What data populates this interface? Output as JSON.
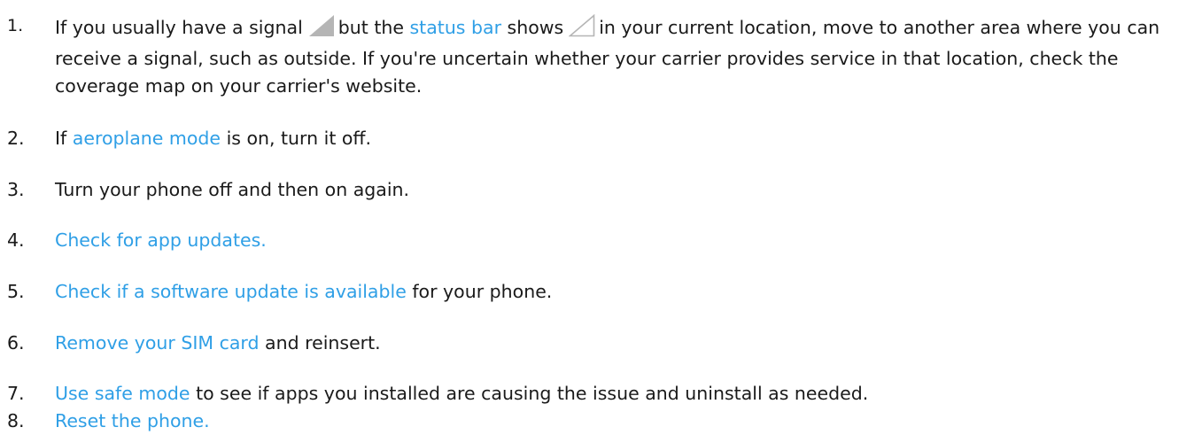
{
  "steps": [
    {
      "number": "1.",
      "parts": {
        "a": "If you usually have a signal",
        "b": "but the",
        "link": "status bar",
        "c": "shows",
        "d": "in your current location, move to another area where you can receive a signal, such as outside. If you're uncertain whether your carrier provides service in that location, check the coverage map on your carrier's website."
      },
      "icons": [
        "signal-full-icon",
        "signal-empty-icon"
      ]
    },
    {
      "number": "2.",
      "parts": {
        "pre": "If",
        "link": "aeroplane mode",
        "post": "is on, turn it off."
      }
    },
    {
      "number": "3.",
      "parts": {
        "text": "Turn your phone off and then on again."
      }
    },
    {
      "number": "4.",
      "parts": {
        "link": "Check for app updates."
      }
    },
    {
      "number": "5.",
      "parts": {
        "link": "Check if a software update is available",
        "post": "for your phone."
      }
    },
    {
      "number": "6.",
      "parts": {
        "link": "Remove your SIM card",
        "post": "and reinsert."
      }
    },
    {
      "number": "7.",
      "parts": {
        "link": "Use safe mode",
        "post": "to see if apps you installed are causing the issue and uninstall as needed."
      }
    },
    {
      "number": "8.",
      "parts": {
        "link": "Reset the phone."
      }
    }
  ],
  "colors": {
    "link": "#2f9fe6",
    "text": "#1a1a1a",
    "signal_fill": "#b5b5b5",
    "signal_outline": "#b5b5b5"
  }
}
